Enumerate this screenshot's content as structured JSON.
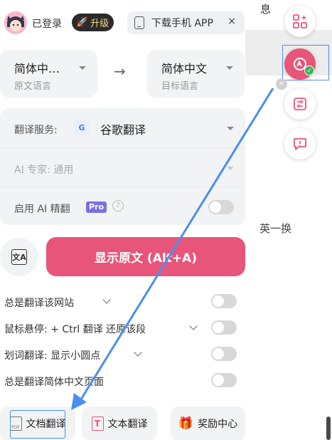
{
  "background": {
    "text_top": "息",
    "text_mid": "英一换"
  },
  "header": {
    "login_status": "已登录",
    "upgrade_label": "升级",
    "download_label": "下载手机 APP",
    "close_label": "×"
  },
  "languages": {
    "source": {
      "value": "简体中…",
      "caption": "原文语言"
    },
    "arrow": "→",
    "target": {
      "value": "简体中文",
      "caption": "目标语言"
    }
  },
  "service": {
    "label": "翻译服务:",
    "engine_icon": "G",
    "engine": "谷歌翻译",
    "expert_label": "AI 专家:",
    "expert_value": "通用",
    "ai_label": "启用 AI 精翻",
    "pro_badge": "Pro",
    "help": "?",
    "ai_enabled": false
  },
  "actions": {
    "swap_glyph": "文A",
    "show_original": "显示原文 (Alt+A)"
  },
  "options": [
    {
      "label": "总是翻译该网站",
      "enabled": false
    },
    {
      "label": "鼠标悬停: + Ctrl 翻译 还原该段",
      "enabled": false
    },
    {
      "label": "划词翻译: 显示小圆点",
      "enabled": false
    },
    {
      "label": "总是翻译简体中文页面",
      "enabled": false
    }
  ],
  "bottom": {
    "doc": "文档翻译",
    "pdf_glyph": "PDF",
    "text": "文本翻译",
    "text_glyph": "T",
    "reward": "奖励中心",
    "reward_glyph": "🎁"
  },
  "floating": {
    "feedback_glyph": "!",
    "check_glyph": "✓",
    "close_glyph": "×"
  },
  "colors": {
    "accent": "#e8557a",
    "highlight": "#4b8ef0",
    "pro": "#7c6fe0"
  }
}
